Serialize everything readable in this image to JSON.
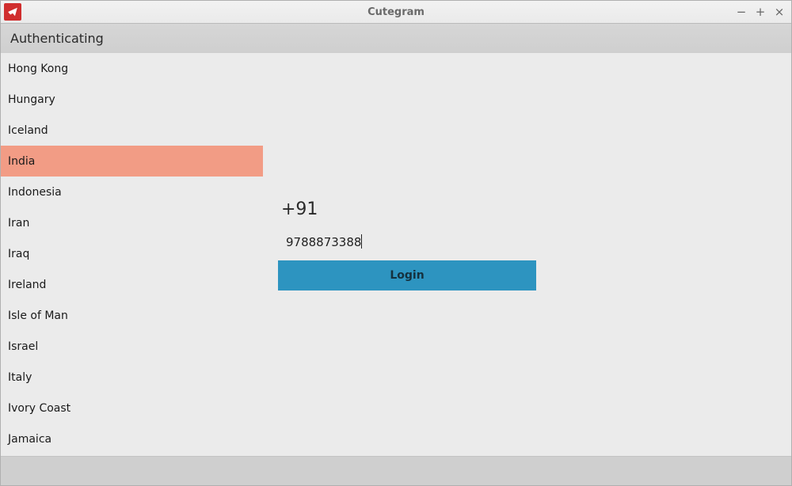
{
  "window": {
    "title": "Cutegram",
    "controls": {
      "minimize": "−",
      "maximize": "+",
      "close": "×"
    }
  },
  "subheader": {
    "text": "Authenticating"
  },
  "country_list": [
    {
      "name": "Hong Kong",
      "selected": false
    },
    {
      "name": "Hungary",
      "selected": false
    },
    {
      "name": "Iceland",
      "selected": false
    },
    {
      "name": "India",
      "selected": true
    },
    {
      "name": "Indonesia",
      "selected": false
    },
    {
      "name": "Iran",
      "selected": false
    },
    {
      "name": "Iraq",
      "selected": false
    },
    {
      "name": "Ireland",
      "selected": false
    },
    {
      "name": "Isle of Man",
      "selected": false
    },
    {
      "name": "Israel",
      "selected": false
    },
    {
      "name": "Italy",
      "selected": false
    },
    {
      "name": "Ivory Coast",
      "selected": false
    },
    {
      "name": "Jamaica",
      "selected": false
    }
  ],
  "login": {
    "dial_code": "+91",
    "phone_value": "9788873388",
    "button_label": "Login"
  },
  "colors": {
    "selected_bg": "#f29c85",
    "button_bg": "#2d94c0"
  }
}
